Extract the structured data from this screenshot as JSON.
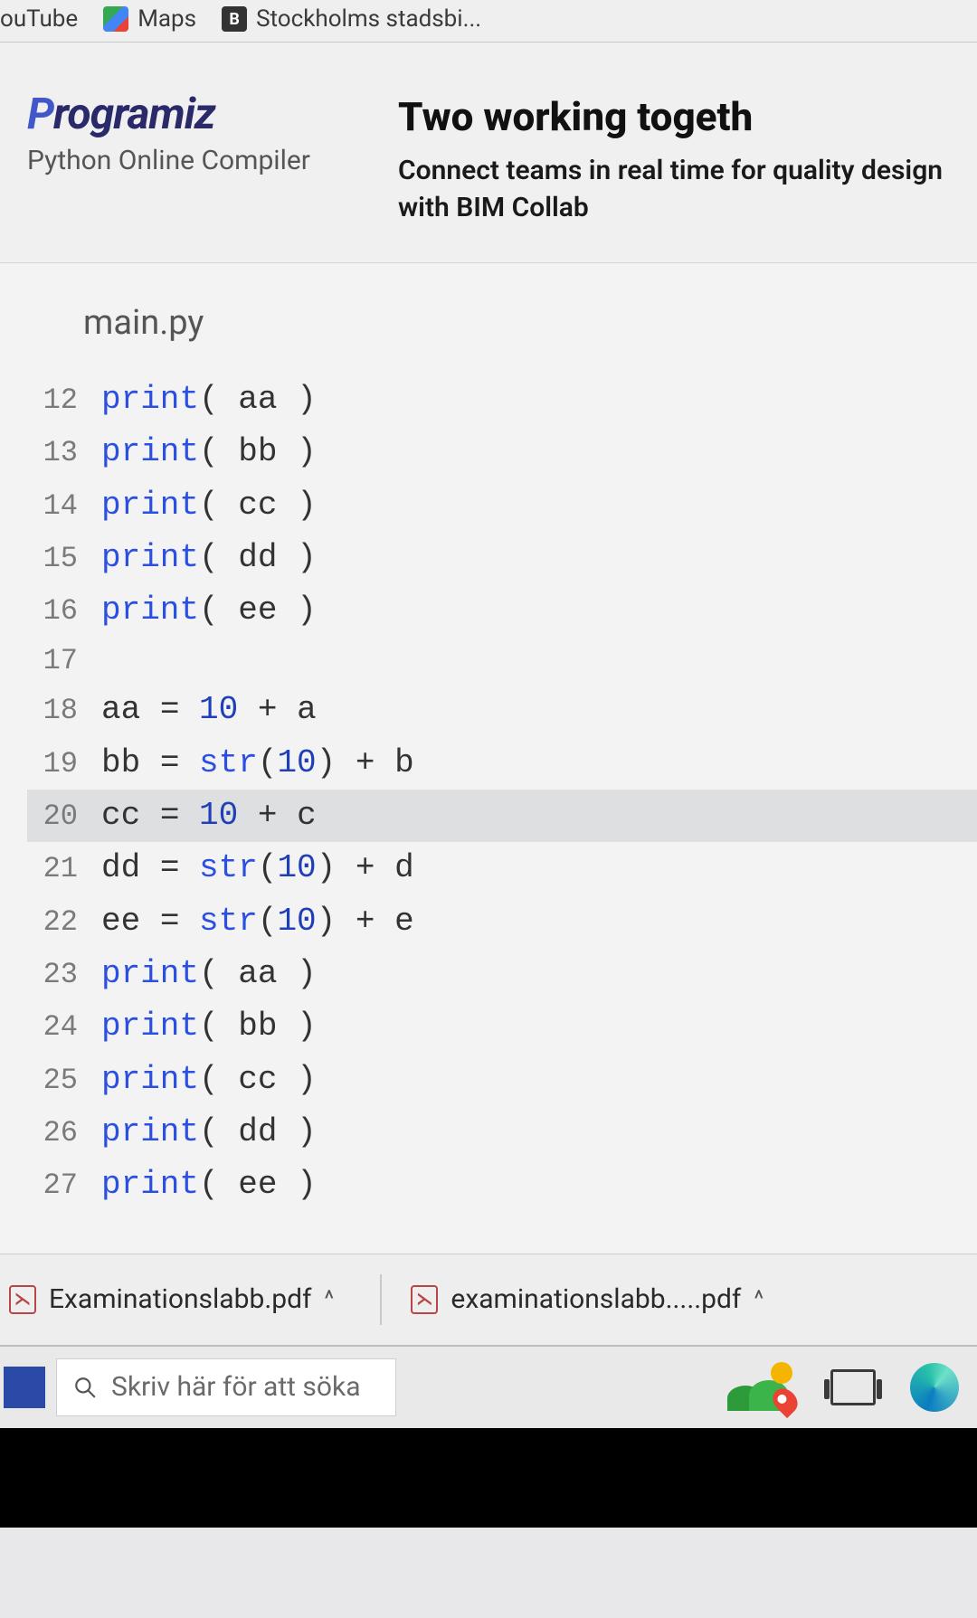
{
  "bookmarks": {
    "youtube": "ouTube",
    "maps": "Maps",
    "stads": "Stockholms stadsbi...",
    "stads_badge": "B"
  },
  "brand": {
    "logo_rest": "rogramiz",
    "subtitle": "Python Online Compiler"
  },
  "ad": {
    "title": "Two working togeth",
    "body": "Connect teams in real time for quality design with BIM Collab"
  },
  "editor": {
    "filename": "main.py",
    "lines": [
      {
        "n": "12",
        "segs": [
          [
            "kw",
            "print"
          ],
          [
            "pn",
            "( "
          ],
          [
            "id",
            "aa"
          ],
          [
            "pn",
            " )"
          ]
        ]
      },
      {
        "n": "13",
        "segs": [
          [
            "kw",
            "print"
          ],
          [
            "pn",
            "( "
          ],
          [
            "id",
            "bb"
          ],
          [
            "pn",
            " )"
          ]
        ]
      },
      {
        "n": "14",
        "segs": [
          [
            "kw",
            "print"
          ],
          [
            "pn",
            "( "
          ],
          [
            "id",
            "cc"
          ],
          [
            "pn",
            " )"
          ]
        ]
      },
      {
        "n": "15",
        "segs": [
          [
            "kw",
            "print"
          ],
          [
            "pn",
            "( "
          ],
          [
            "id",
            "dd"
          ],
          [
            "pn",
            " )"
          ]
        ]
      },
      {
        "n": "16",
        "segs": [
          [
            "kw",
            "print"
          ],
          [
            "pn",
            "( "
          ],
          [
            "id",
            "ee"
          ],
          [
            "pn",
            " )"
          ]
        ]
      },
      {
        "n": "17",
        "segs": []
      },
      {
        "n": "18",
        "segs": [
          [
            "id",
            "aa "
          ],
          [
            "op",
            "= "
          ],
          [
            "num",
            "10"
          ],
          [
            "op",
            " + "
          ],
          [
            "id",
            "a"
          ]
        ]
      },
      {
        "n": "19",
        "segs": [
          [
            "id",
            "bb "
          ],
          [
            "op",
            "= "
          ],
          [
            "fn",
            "str"
          ],
          [
            "pn",
            "("
          ],
          [
            "num",
            "10"
          ],
          [
            "pn",
            ")"
          ],
          [
            "op",
            " + "
          ],
          [
            "id",
            "b"
          ]
        ]
      },
      {
        "n": "20",
        "hl": true,
        "segs": [
          [
            "id",
            "cc "
          ],
          [
            "op",
            "= "
          ],
          [
            "num",
            "10"
          ],
          [
            "op",
            " + "
          ],
          [
            "id",
            "c"
          ]
        ]
      },
      {
        "n": "21",
        "segs": [
          [
            "id",
            "dd "
          ],
          [
            "op",
            "= "
          ],
          [
            "fn",
            "str"
          ],
          [
            "pn",
            "("
          ],
          [
            "num",
            "10"
          ],
          [
            "pn",
            ")"
          ],
          [
            "op",
            " + "
          ],
          [
            "id",
            "d"
          ]
        ]
      },
      {
        "n": "22",
        "segs": [
          [
            "id",
            "ee "
          ],
          [
            "op",
            "= "
          ],
          [
            "fn",
            "str"
          ],
          [
            "pn",
            "("
          ],
          [
            "num",
            "10"
          ],
          [
            "pn",
            ")"
          ],
          [
            "op",
            " + "
          ],
          [
            "id",
            "e"
          ]
        ]
      },
      {
        "n": "23",
        "segs": [
          [
            "kw",
            "print"
          ],
          [
            "pn",
            "( "
          ],
          [
            "id",
            "aa"
          ],
          [
            "pn",
            " )"
          ]
        ]
      },
      {
        "n": "24",
        "segs": [
          [
            "kw",
            "print"
          ],
          [
            "pn",
            "( "
          ],
          [
            "id",
            "bb"
          ],
          [
            "pn",
            " )"
          ]
        ]
      },
      {
        "n": "25",
        "segs": [
          [
            "kw",
            "print"
          ],
          [
            "pn",
            "( "
          ],
          [
            "id",
            "cc"
          ],
          [
            "pn",
            " )"
          ]
        ]
      },
      {
        "n": "26",
        "segs": [
          [
            "kw",
            "print"
          ],
          [
            "pn",
            "( "
          ],
          [
            "id",
            "dd"
          ],
          [
            "pn",
            " )"
          ]
        ]
      },
      {
        "n": "27",
        "segs": [
          [
            "kw",
            "print"
          ],
          [
            "pn",
            "( "
          ],
          [
            "id",
            "ee"
          ],
          [
            "pn",
            " )"
          ]
        ]
      }
    ]
  },
  "downloads": {
    "item1": "Examinationslabb.pdf",
    "item2": "examinationslabb.....pdf",
    "chevron": "^",
    "pdf_glyph": "⋋"
  },
  "taskbar": {
    "search_placeholder": "Skriv här för att söka"
  }
}
